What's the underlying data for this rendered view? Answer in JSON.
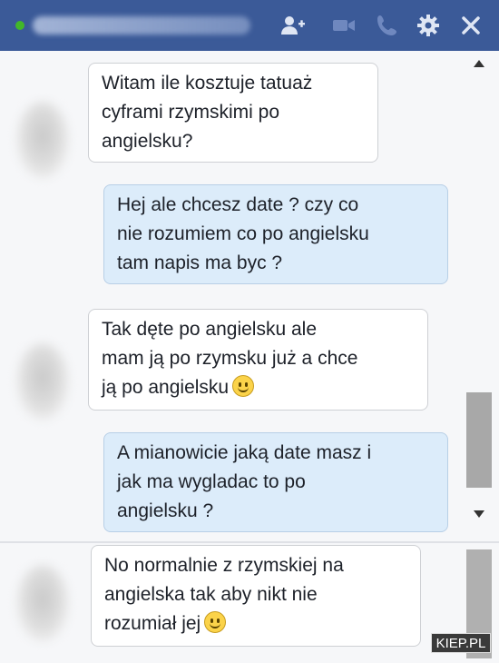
{
  "header": {
    "background": "#3b5a98",
    "icons": [
      "add-friend-icon",
      "video-call-icon",
      "phone-icon",
      "gear-icon",
      "close-icon"
    ]
  },
  "messages": [
    {
      "from": "them",
      "text": "Witam ile kosztuje tatuaż\ncyframi rzymskimi po\nangielsku?"
    },
    {
      "from": "me",
      "text": "Hej ale chcesz date ? czy co\nnie rozumiem co po angielsku\ntam napis ma byc ?"
    },
    {
      "from": "them",
      "text": "Tak dęte po angielsku ale\nmam ją po rzymsku już a chce\nją po angielsku"
    },
    {
      "from": "me",
      "text": "A mianowicie jaką date masz i\njak ma wygladac to po\nangielsku ?"
    },
    {
      "from": "them",
      "text": "No normalnie z rzymskiej na\nangielska tak aby nikt nie\nrozumiał jej"
    }
  ],
  "watermark": "KIEP.PL"
}
